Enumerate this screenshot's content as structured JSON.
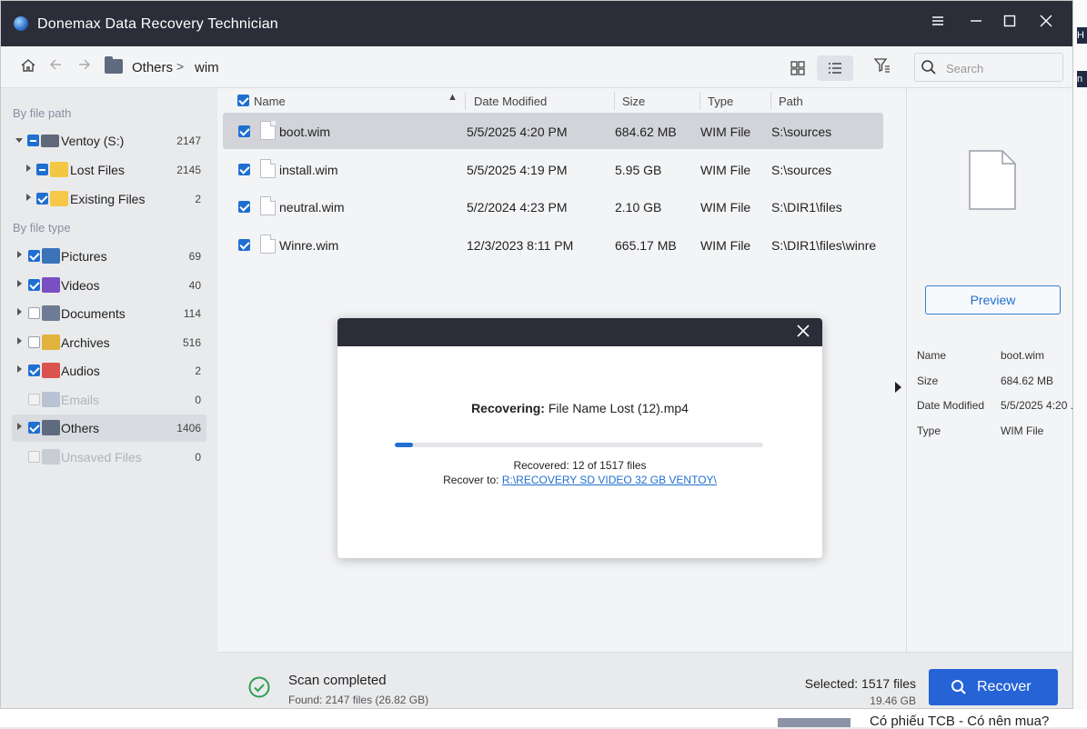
{
  "app": {
    "title": "Donemax Data Recovery  Technician"
  },
  "toolbar": {
    "breadcrumb": [
      "Others",
      "wim"
    ],
    "breadcrumb_sep": ">",
    "search_placeholder": "Search"
  },
  "sidebar": {
    "by_path_label": "By file path",
    "by_type_label": "By file type",
    "path_items": [
      {
        "label": "Ventoy (S:)",
        "count": "2147",
        "check": "partial",
        "expanded": true
      },
      {
        "label": "Lost Files",
        "count": "2145",
        "check": "partial"
      },
      {
        "label": "Existing Files",
        "count": "2",
        "check": "checked"
      }
    ],
    "type_items": [
      {
        "label": "Pictures",
        "count": "69",
        "check": "checked"
      },
      {
        "label": "Videos",
        "count": "40",
        "check": "checked"
      },
      {
        "label": "Documents",
        "count": "114",
        "check": "unchecked"
      },
      {
        "label": "Archives",
        "count": "516",
        "check": "unchecked"
      },
      {
        "label": "Audios",
        "count": "2",
        "check": "checked"
      },
      {
        "label": "Emails",
        "count": "0",
        "check": "disabled"
      },
      {
        "label": "Others",
        "count": "1406",
        "check": "checked",
        "selected": true
      },
      {
        "label": "Unsaved Files",
        "count": "0",
        "check": "disabled"
      }
    ]
  },
  "file_list": {
    "columns": [
      "Name",
      "Date Modified",
      "Size",
      "Type",
      "Path"
    ],
    "rows": [
      {
        "name": "boot.wim",
        "date": "5/5/2025 4:20 PM",
        "size": "684.62 MB",
        "type": "WIM File",
        "path": "S:\\sources",
        "selected": true
      },
      {
        "name": "install.wim",
        "date": "5/5/2025 4:19 PM",
        "size": "5.95 GB",
        "type": "WIM File",
        "path": "S:\\sources"
      },
      {
        "name": "neutral.wim",
        "date": "5/2/2024 4:23 PM",
        "size": "2.10 GB",
        "type": "WIM File",
        "path": "S:\\DIR1\\files"
      },
      {
        "name": "Winre.wim",
        "date": "12/3/2023 8:11 PM",
        "size": "665.17 MB",
        "type": "WIM File",
        "path": "S:\\DIR1\\files\\winre"
      }
    ]
  },
  "preview": {
    "button_label": "Preview",
    "meta": [
      {
        "key": "Name",
        "value": "boot.wim"
      },
      {
        "key": "Size",
        "value": "684.62 MB"
      },
      {
        "key": "Date Modified",
        "value": "5/5/2025 4:20 ..."
      },
      {
        "key": "Type",
        "value": "WIM File"
      }
    ]
  },
  "status": {
    "scan_title": "Scan completed",
    "scan_sub": "Found: 2147 files (26.82 GB)",
    "selected_title": "Selected: 1517 files",
    "selected_size": "19.46 GB",
    "recover_label": "Recover"
  },
  "dialog": {
    "status_prefix": "Recovering:",
    "status_file": "File Name Lost (12).mp4",
    "progress": 0.05,
    "count_text": "Recovered: 12 of 1517 files",
    "dest_prefix": "Recover to:",
    "dest_path": "R:\\RECOVERY SD VIDEO 32 GB VENTOY\\"
  },
  "background": {
    "right_chip1": "H",
    "right_chip2": "n",
    "bottom_news": "Có phiếu TCB - Có nên mua?"
  },
  "colors": {
    "accent": "#1f6fd1",
    "titlebar": "#2b2d38",
    "success": "#2e9e52"
  }
}
